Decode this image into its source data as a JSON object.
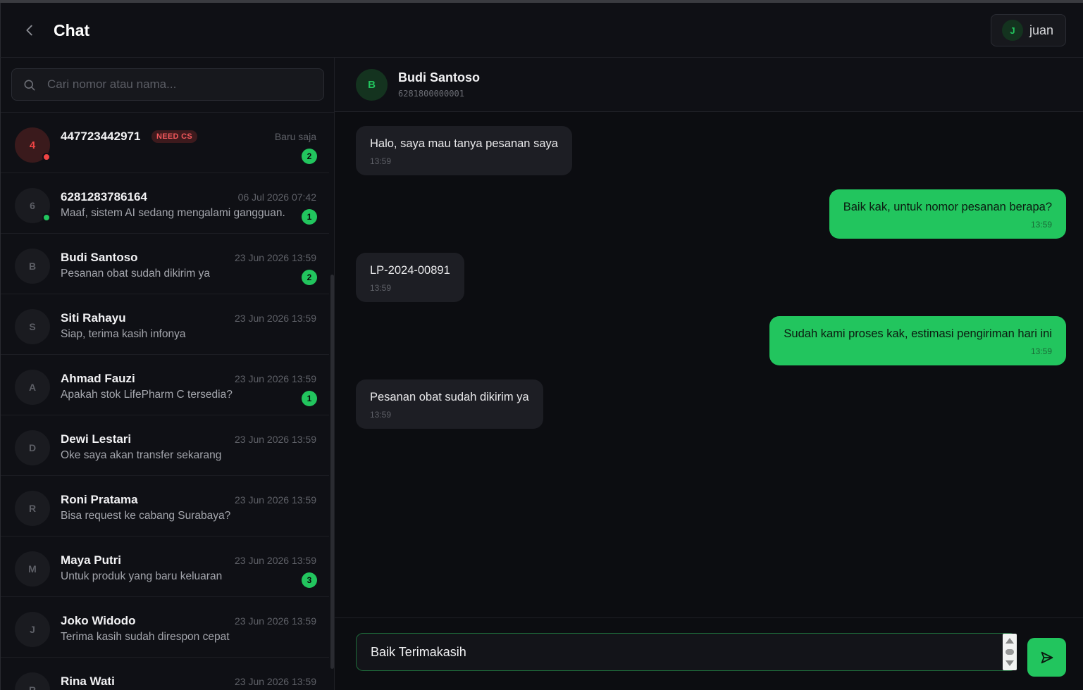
{
  "header": {
    "title": "Chat",
    "user": {
      "initial": "J",
      "name": "juan"
    }
  },
  "search": {
    "placeholder": "Cari nomor atau nama..."
  },
  "conversations": [
    {
      "initial": "4",
      "name": "447723442971",
      "badge": "NEED CS",
      "time": "Baru saja",
      "preview": "",
      "count": "2",
      "status": "red"
    },
    {
      "initial": "6",
      "name": "6281283786164",
      "time": "06 Jul 2026 07:42",
      "preview": "Maaf, sistem AI sedang mengalami gangguan.",
      "count": "1",
      "status": "green"
    },
    {
      "initial": "B",
      "name": "Budi Santoso",
      "time": "23 Jun 2026 13:59",
      "preview": "Pesanan obat sudah dikirim ya",
      "count": "2"
    },
    {
      "initial": "S",
      "name": "Siti Rahayu",
      "time": "23 Jun 2026 13:59",
      "preview": "Siap, terima kasih infonya"
    },
    {
      "initial": "A",
      "name": "Ahmad Fauzi",
      "time": "23 Jun 2026 13:59",
      "preview": "Apakah stok LifePharm C tersedia?",
      "count": "1"
    },
    {
      "initial": "D",
      "name": "Dewi Lestari",
      "time": "23 Jun 2026 13:59",
      "preview": "Oke saya akan transfer sekarang"
    },
    {
      "initial": "R",
      "name": "Roni Pratama",
      "time": "23 Jun 2026 13:59",
      "preview": "Bisa request ke cabang Surabaya?"
    },
    {
      "initial": "M",
      "name": "Maya Putri",
      "time": "23 Jun 2026 13:59",
      "preview": "Untuk produk yang baru keluaran",
      "count": "3"
    },
    {
      "initial": "J",
      "name": "Joko Widodo",
      "time": "23 Jun 2026 13:59",
      "preview": "Terima kasih sudah direspon cepat"
    },
    {
      "initial": "R",
      "name": "Rina Wati",
      "time": "23 Jun 2026 13:59",
      "preview": ""
    }
  ],
  "contact": {
    "initial": "B",
    "name": "Budi Santoso",
    "phone": "6281800000001"
  },
  "messages": [
    {
      "dir": "in",
      "text": "Halo, saya mau tanya pesanan saya",
      "time": "13:59"
    },
    {
      "dir": "out",
      "text": "Baik kak, untuk nomor pesanan berapa?",
      "time": "13:59"
    },
    {
      "dir": "in",
      "text": "LP-2024-00891",
      "time": "13:59"
    },
    {
      "dir": "out",
      "text": "Sudah kami proses kak, estimasi pengiriman hari ini",
      "time": "13:59"
    },
    {
      "dir": "in",
      "text": "Pesanan obat sudah dikirim ya",
      "time": "13:59"
    }
  ],
  "composer": {
    "value": "Baik Terimakasih"
  },
  "colors": {
    "accent": "#22c55e",
    "alert": "#ef4444",
    "background": "#0c0d11"
  }
}
